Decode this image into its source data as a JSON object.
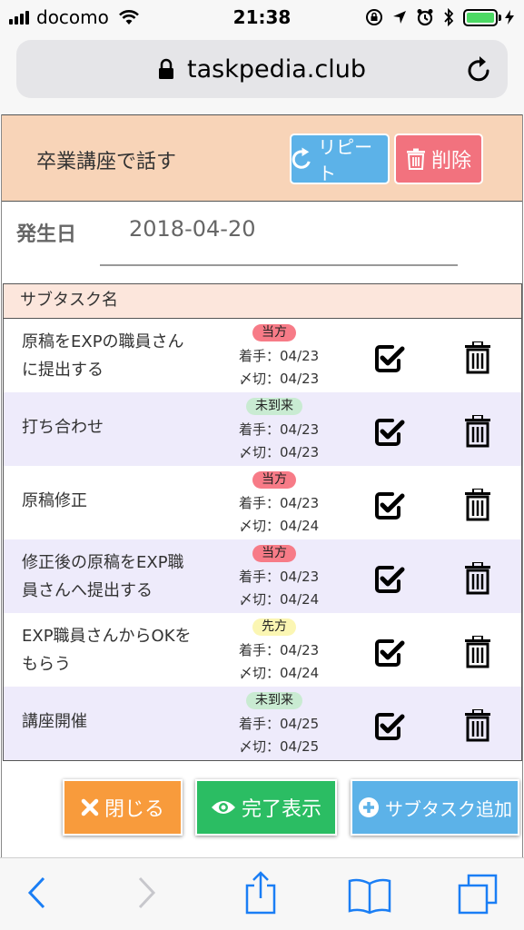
{
  "status_bar": {
    "carrier": "docomo",
    "time": "21:38"
  },
  "browser": {
    "url": "taskpedia.club"
  },
  "task": {
    "title": "卒業講座で話す",
    "repeat_label": "リピート",
    "delete_label": "削除",
    "date_label": "発生日",
    "date_value": "2018-04-20"
  },
  "subtasks": {
    "column_header": "サブタスク名",
    "rows": [
      {
        "name_line1": "原稿をEXPの職員さん",
        "name_line2": "に提出する",
        "badge": "当方",
        "start": "着手：04/23",
        "due": "〆切：04/23"
      },
      {
        "name_line1": "打ち合わせ",
        "badge": "未到来",
        "start": "着手：04/23",
        "due": "〆切：04/23"
      },
      {
        "name_line1": "原稿修正",
        "badge": "当方",
        "start": "着手：04/23",
        "due": "〆切：04/24"
      },
      {
        "name_line1": "修正後の原稿をEXP職",
        "name_line2": "員さんへ提出する",
        "badge": "当方",
        "start": "着手：04/23",
        "due": "〆切：04/24"
      },
      {
        "name_line1": "EXP職員さんからOKを",
        "name_line2": "もらう",
        "badge": "先方",
        "start": "着手：04/23",
        "due": "〆切：04/24"
      },
      {
        "name_line1": "講座開催",
        "badge": "未到来",
        "start": "着手：04/25",
        "due": "〆切：04/25"
      }
    ]
  },
  "footer": {
    "close_label": "閉じる",
    "show_done_label": "完了表示",
    "add_subtask_label": "サブタスク追加"
  },
  "colors": {
    "header_bg": "#f8d4b8",
    "alt_row_bg": "#eeebfb",
    "badge_ours": "#f77b87",
    "badge_not_yet": "#c9ebd2",
    "badge_theirs": "#fbf6b3",
    "repeat_btn": "#5cb2e8",
    "delete_btn": "#f2727e",
    "close_btn": "#f89b3c",
    "done_btn": "#2bbd63",
    "add_btn": "#5cb2e8"
  },
  "icons": [
    "signal-icon",
    "wifi-icon",
    "lock-icon",
    "reload-icon",
    "repeat-icon",
    "trash-icon",
    "check-icon",
    "close-x-icon",
    "eye-icon",
    "plus-circle-icon",
    "back-icon",
    "forward-icon",
    "share-icon",
    "bookmarks-icon",
    "tabs-icon"
  ]
}
